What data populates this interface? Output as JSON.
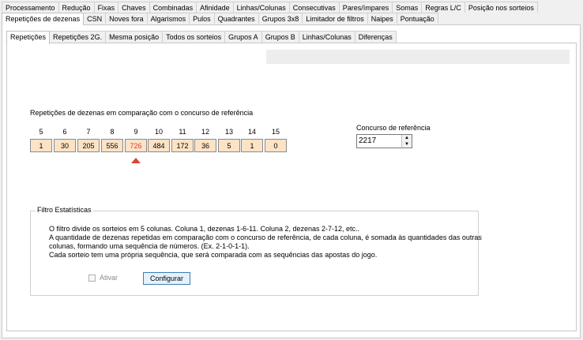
{
  "main_tabs_row1": [
    "Processamento",
    "Redução",
    "Fixas",
    "Chaves",
    "Combinadas",
    "Afinidade",
    "Linhas/Colunas",
    "Consecutivas",
    "Pares/ímpares",
    "Somas",
    "Regras L/C",
    "Posição nos sorteios"
  ],
  "main_tabs_row2": [
    "Repetições de dezenas",
    "CSN",
    "Noves fora",
    "Algarismos",
    "Pulos",
    "Quadrantes",
    "Grupos 3x8",
    "Limitador de filtros",
    "Naipes",
    "Pontuação"
  ],
  "sub_tabs": [
    "Repetições",
    "Repetições 2G.",
    "Mesma posição",
    "Todos os sorteios",
    "Grupos A",
    "Grupos B",
    "Linhas/Colunas",
    "Diferenças"
  ],
  "heading": "Repetições de dezenas em comparação com o concurso de referência",
  "columns": [
    {
      "label": "5",
      "value": "1"
    },
    {
      "label": "6",
      "value": "30"
    },
    {
      "label": "7",
      "value": "205"
    },
    {
      "label": "8",
      "value": "556"
    },
    {
      "label": "9",
      "value": "726"
    },
    {
      "label": "10",
      "value": "484"
    },
    {
      "label": "11",
      "value": "172"
    },
    {
      "label": "12",
      "value": "36"
    },
    {
      "label": "13",
      "value": "5"
    },
    {
      "label": "14",
      "value": "1"
    },
    {
      "label": "15",
      "value": "0"
    }
  ],
  "highlight_color": "#e23b2e",
  "box_color": "#fde3c6",
  "reference": {
    "label": "Concurso de referência",
    "value": "2217"
  },
  "filter": {
    "legend": "Filtro Estatísticas",
    "lines": [
      "O filtro divide os sorteios em 5 colunas. Coluna 1, dezenas 1-6-11. Coluna 2, dezenas 2-7-12, etc..",
      "A quantidade de dezenas repetidas em comparação com o concurso de referência, de cada coluna, é somada às quantidades das outras",
      "colunas, formando uma sequência de números. (Ex. 2-1-0-1-1).",
      "Cada sorteio tem uma própria sequência, que será comparada com as sequências das apostas do jogo."
    ],
    "checkbox_label": "Ativar",
    "button_label": "Configurar"
  }
}
